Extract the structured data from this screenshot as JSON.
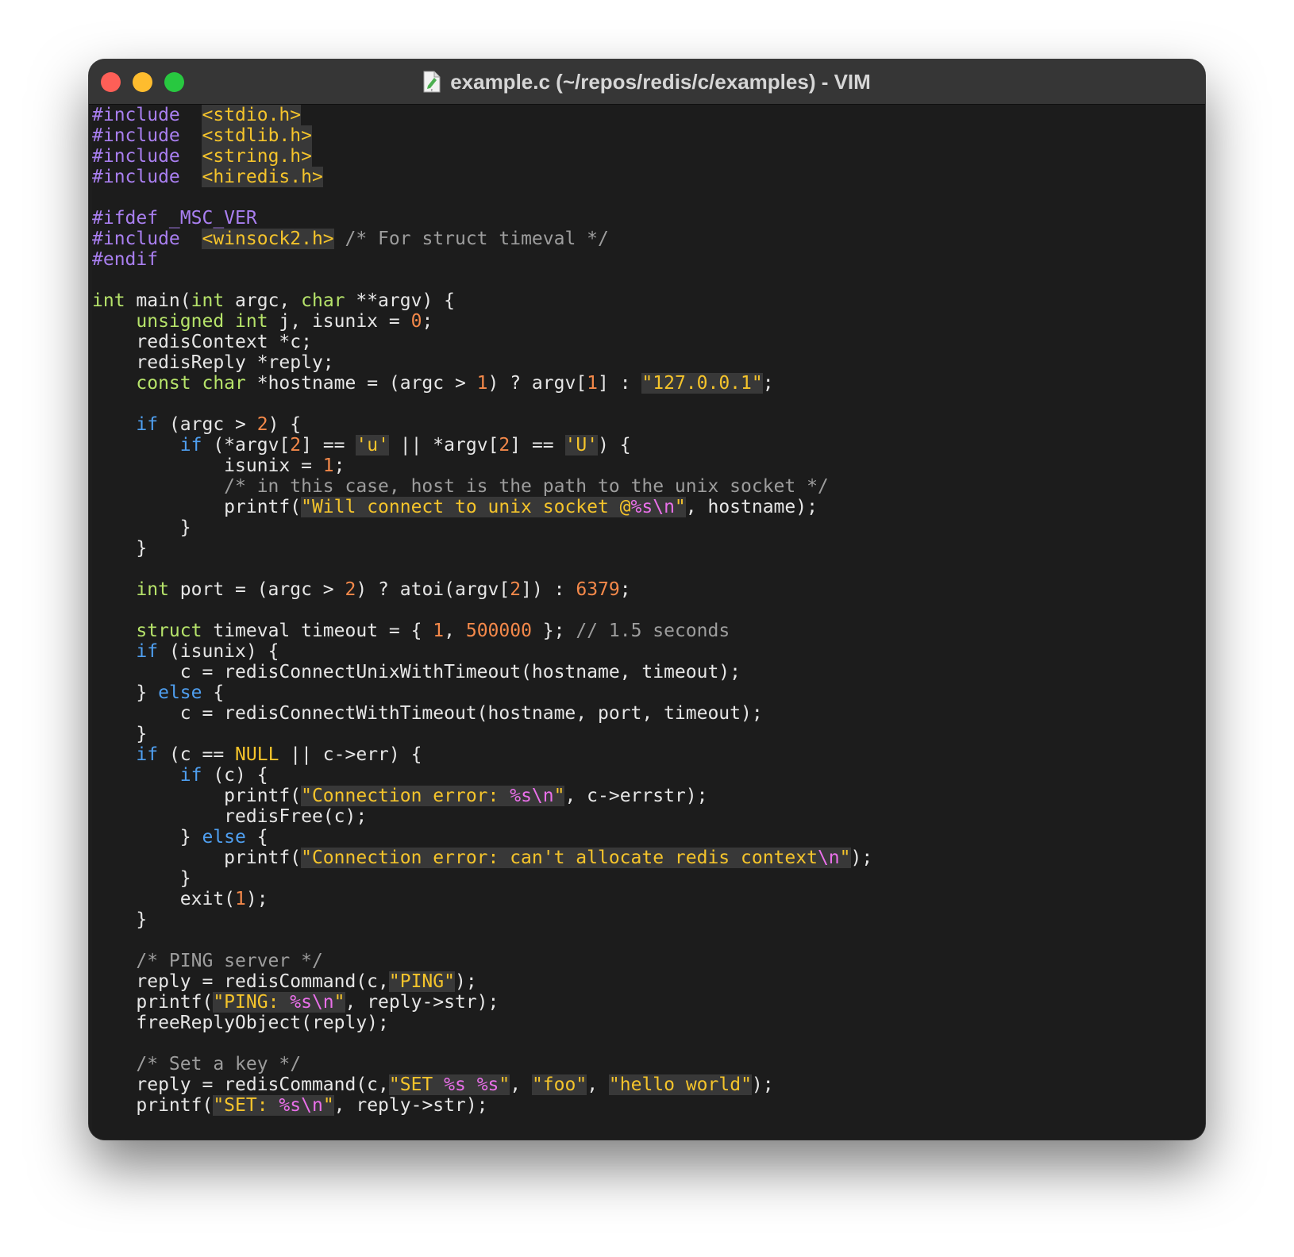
{
  "window": {
    "title": "example.c (~/repos/redis/c/examples) - VIM",
    "file_icon": "c-source-file-icon",
    "traffic_lights": {
      "close": "#fe5f57",
      "minimize": "#febc2e",
      "maximize": "#28c840"
    }
  },
  "theme": {
    "background": "#1c1c1c",
    "foreground": "#e6e6e6",
    "preprocessor": "#a97ff0",
    "type": "#b6e36a",
    "keyword": "#4f9ff0",
    "number": "#f5894a",
    "string": "#f5c42b",
    "string_background": "#383838",
    "escape": "#ea70ea",
    "comment": "#9d9d9d"
  },
  "editor": {
    "lines": [
      [
        [
          "pp",
          "#include"
        ],
        [
          "",
          "  "
        ],
        [
          "str",
          "<stdio.h>"
        ]
      ],
      [
        [
          "pp",
          "#include"
        ],
        [
          "",
          "  "
        ],
        [
          "str",
          "<stdlib.h>"
        ]
      ],
      [
        [
          "pp",
          "#include"
        ],
        [
          "",
          "  "
        ],
        [
          "str",
          "<string.h>"
        ]
      ],
      [
        [
          "pp",
          "#include"
        ],
        [
          "",
          "  "
        ],
        [
          "str",
          "<hiredis.h>"
        ]
      ],
      [],
      [
        [
          "pp",
          "#ifdef _MSC_VER"
        ]
      ],
      [
        [
          "pp",
          "#include"
        ],
        [
          "",
          "  "
        ],
        [
          "str",
          "<winsock2.h>"
        ],
        [
          "",
          " "
        ],
        [
          "cm",
          "/* For struct timeval */"
        ]
      ],
      [
        [
          "pp",
          "#endif"
        ]
      ],
      [],
      [
        [
          "ty",
          "int"
        ],
        [
          "",
          " main("
        ],
        [
          "ty",
          "int"
        ],
        [
          "",
          " argc, "
        ],
        [
          "ty",
          "char"
        ],
        [
          "",
          " **argv) {"
        ]
      ],
      [
        [
          "",
          "    "
        ],
        [
          "ty",
          "unsigned int"
        ],
        [
          "",
          " j, isunix = "
        ],
        [
          "num",
          "0"
        ],
        [
          "",
          ";"
        ]
      ],
      [
        [
          "",
          "    redisContext *c;"
        ]
      ],
      [
        [
          "",
          "    redisReply *reply;"
        ]
      ],
      [
        [
          "",
          "    "
        ],
        [
          "ty",
          "const char"
        ],
        [
          "",
          " *hostname = (argc > "
        ],
        [
          "num",
          "1"
        ],
        [
          "",
          ") ? argv["
        ],
        [
          "num",
          "1"
        ],
        [
          "",
          "] : "
        ],
        [
          "str",
          "\"127.0.0.1\""
        ],
        [
          "",
          ";"
        ]
      ],
      [],
      [
        [
          "",
          "    "
        ],
        [
          "kw",
          "if"
        ],
        [
          "",
          " (argc > "
        ],
        [
          "num",
          "2"
        ],
        [
          "",
          ") {"
        ]
      ],
      [
        [
          "",
          "        "
        ],
        [
          "kw",
          "if"
        ],
        [
          "",
          " (*argv["
        ],
        [
          "num",
          "2"
        ],
        [
          "",
          "] == "
        ],
        [
          "str",
          "'u'"
        ],
        [
          "",
          " || *argv["
        ],
        [
          "num",
          "2"
        ],
        [
          "",
          "] == "
        ],
        [
          "str",
          "'U'"
        ],
        [
          "",
          ") {"
        ]
      ],
      [
        [
          "",
          "            isunix = "
        ],
        [
          "num",
          "1"
        ],
        [
          "",
          ";"
        ]
      ],
      [
        [
          "",
          "            "
        ],
        [
          "cm",
          "/* in this case, host is the path to the unix socket */"
        ]
      ],
      [
        [
          "",
          "            printf("
        ],
        [
          "str",
          "\"Will connect to unix socket @"
        ],
        [
          "esc",
          "%s\\n"
        ],
        [
          "str",
          "\""
        ],
        [
          "",
          ", hostname);"
        ]
      ],
      [
        [
          "",
          "        }"
        ]
      ],
      [
        [
          "",
          "    }"
        ]
      ],
      [],
      [
        [
          "",
          "    "
        ],
        [
          "ty",
          "int"
        ],
        [
          "",
          " port = (argc > "
        ],
        [
          "num",
          "2"
        ],
        [
          "",
          ") ? atoi(argv["
        ],
        [
          "num",
          "2"
        ],
        [
          "",
          "]) : "
        ],
        [
          "num",
          "6379"
        ],
        [
          "",
          ";"
        ]
      ],
      [],
      [
        [
          "",
          "    "
        ],
        [
          "ty",
          "struct"
        ],
        [
          "",
          " timeval timeout = { "
        ],
        [
          "num",
          "1"
        ],
        [
          "",
          ", "
        ],
        [
          "num",
          "500000"
        ],
        [
          "",
          " }; "
        ],
        [
          "cm",
          "// 1.5 seconds"
        ]
      ],
      [
        [
          "",
          "    "
        ],
        [
          "kw",
          "if"
        ],
        [
          "",
          " (isunix) {"
        ]
      ],
      [
        [
          "",
          "        c = redisConnectUnixWithTimeout(hostname, timeout);"
        ]
      ],
      [
        [
          "",
          "    } "
        ],
        [
          "kw",
          "else"
        ],
        [
          "",
          " {"
        ]
      ],
      [
        [
          "",
          "        c = redisConnectWithTimeout(hostname, port, timeout);"
        ]
      ],
      [
        [
          "",
          "    }"
        ]
      ],
      [
        [
          "",
          "    "
        ],
        [
          "kw",
          "if"
        ],
        [
          "",
          " (c == "
        ],
        [
          "null",
          "NULL"
        ],
        [
          "",
          " || c->err) {"
        ]
      ],
      [
        [
          "",
          "        "
        ],
        [
          "kw",
          "if"
        ],
        [
          "",
          " (c) {"
        ]
      ],
      [
        [
          "",
          "            printf("
        ],
        [
          "str",
          "\"Connection error: "
        ],
        [
          "esc",
          "%s\\n"
        ],
        [
          "str",
          "\""
        ],
        [
          "",
          ", c->errstr);"
        ]
      ],
      [
        [
          "",
          "            redisFree(c);"
        ]
      ],
      [
        [
          "",
          "        } "
        ],
        [
          "kw",
          "else"
        ],
        [
          "",
          " {"
        ]
      ],
      [
        [
          "",
          "            printf("
        ],
        [
          "str",
          "\"Connection error: can't allocate redis context"
        ],
        [
          "esc",
          "\\n"
        ],
        [
          "str",
          "\""
        ],
        [
          "",
          ");"
        ]
      ],
      [
        [
          "",
          "        }"
        ]
      ],
      [
        [
          "",
          "        exit("
        ],
        [
          "num",
          "1"
        ],
        [
          "",
          ");"
        ]
      ],
      [
        [
          "",
          "    }"
        ]
      ],
      [],
      [
        [
          "",
          "    "
        ],
        [
          "cm",
          "/* PING server */"
        ]
      ],
      [
        [
          "",
          "    reply = redisCommand(c,"
        ],
        [
          "str",
          "\"PING\""
        ],
        [
          "",
          ");"
        ]
      ],
      [
        [
          "",
          "    printf("
        ],
        [
          "str",
          "\"PING: "
        ],
        [
          "esc",
          "%s\\n"
        ],
        [
          "str",
          "\""
        ],
        [
          "",
          ", reply->str);"
        ]
      ],
      [
        [
          "",
          "    freeReplyObject(reply);"
        ]
      ],
      [],
      [
        [
          "",
          "    "
        ],
        [
          "cm",
          "/* Set a key */"
        ]
      ],
      [
        [
          "",
          "    reply = redisCommand(c,"
        ],
        [
          "str",
          "\"SET "
        ],
        [
          "esc",
          "%s"
        ],
        [
          "str",
          " "
        ],
        [
          "esc",
          "%s"
        ],
        [
          "str",
          "\""
        ],
        [
          "",
          ", "
        ],
        [
          "str",
          "\"foo\""
        ],
        [
          "",
          ", "
        ],
        [
          "str",
          "\"hello world\""
        ],
        [
          "",
          ");"
        ]
      ],
      [
        [
          "",
          "    printf("
        ],
        [
          "str",
          "\"SET: "
        ],
        [
          "esc",
          "%s\\n"
        ],
        [
          "str",
          "\""
        ],
        [
          "",
          ", reply->str);"
        ]
      ]
    ]
  }
}
